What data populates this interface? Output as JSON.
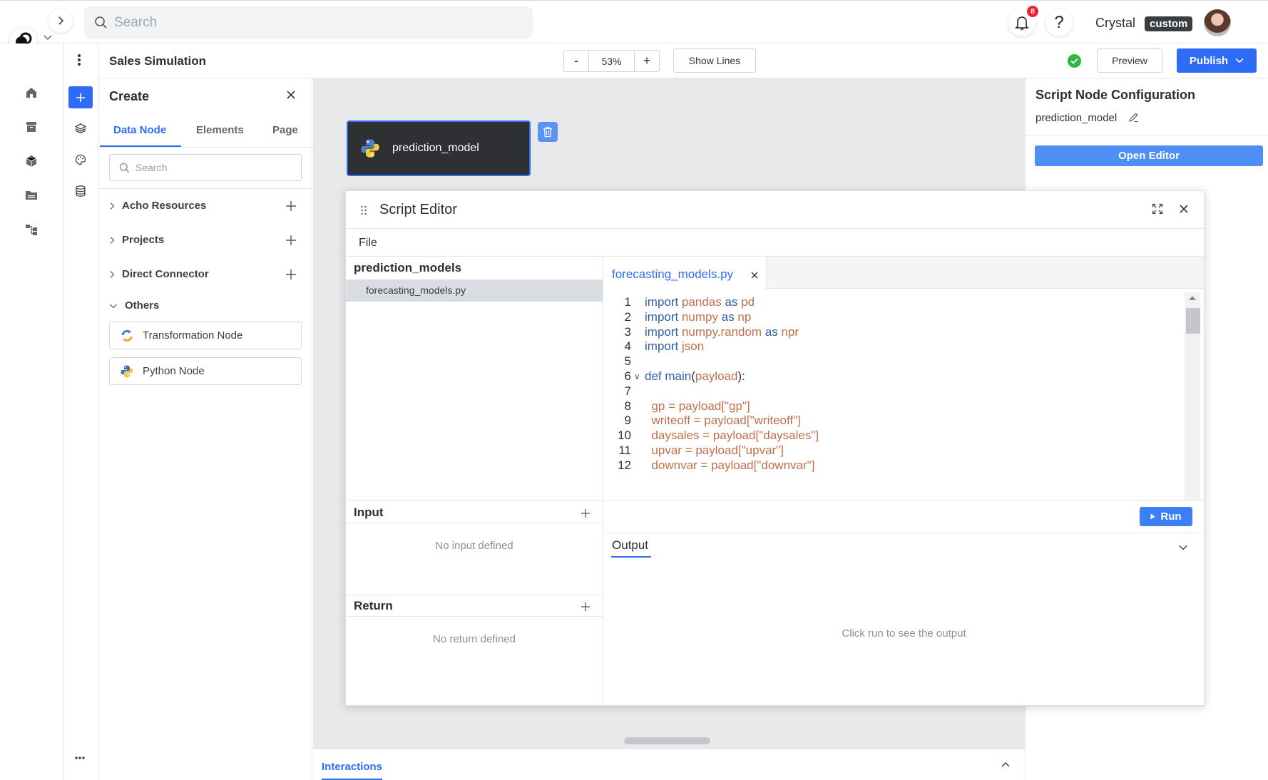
{
  "topbar": {
    "search_placeholder": "Search",
    "notifications_count": "8",
    "help_label": "?",
    "user_name": "Crystal",
    "user_role": "custom"
  },
  "header": {
    "project_title": "Sales Simulation",
    "zoom_minus": "-",
    "zoom_value": "53%",
    "zoom_plus": "+",
    "show_lines": "Show Lines",
    "preview": "Preview",
    "publish": "Publish",
    "status_color": "#2db742"
  },
  "create_panel": {
    "title": "Create",
    "tabs": [
      "Data Node",
      "Elements",
      "Page"
    ],
    "active_tab": "Data Node",
    "search_placeholder": "Search",
    "tree": [
      {
        "label": "Acho Resources"
      },
      {
        "label": "Projects"
      },
      {
        "label": "Direct Connector"
      },
      {
        "label": "Others"
      }
    ],
    "nodes": [
      {
        "label": "Transformation Node",
        "icon": "transformation-icon"
      },
      {
        "label": "Python Node",
        "icon": "python-icon"
      }
    ]
  },
  "canvas": {
    "node_label": "prediction_model"
  },
  "right_panel": {
    "title": "Script Node Configuration",
    "node_name": "prediction_model",
    "open_editor": "Open Editor"
  },
  "script_editor": {
    "title": "Script Editor",
    "menu_file": "File",
    "folder": "prediction_models",
    "file": "forecasting_models.py",
    "tab_label": "forecasting_models.py",
    "input_title": "Input",
    "input_empty": "No input defined",
    "return_title": "Return",
    "return_empty": "No return defined",
    "run": "Run",
    "output_tab": "Output",
    "output_msg": "Click run to see the output",
    "code_lines": [
      {
        "n": "1",
        "parts": [
          [
            "kw",
            "import "
          ],
          [
            "id",
            "pandas"
          ],
          [
            "kw",
            " as "
          ],
          [
            "id",
            "pd"
          ]
        ]
      },
      {
        "n": "2",
        "parts": [
          [
            "kw",
            "import "
          ],
          [
            "id",
            "numpy"
          ],
          [
            "kw",
            " as "
          ],
          [
            "id",
            "np"
          ]
        ]
      },
      {
        "n": "3",
        "parts": [
          [
            "kw",
            "import "
          ],
          [
            "id",
            "numpy.random"
          ],
          [
            "kw",
            " as "
          ],
          [
            "id",
            "npr"
          ]
        ]
      },
      {
        "n": "4",
        "parts": [
          [
            "kw",
            "import "
          ],
          [
            "id",
            "json"
          ]
        ]
      },
      {
        "n": "5",
        "parts": []
      },
      {
        "n": "6",
        "parts": [
          [
            "kw",
            "def "
          ],
          [
            "kw",
            "main"
          ],
          [
            "pl",
            "("
          ],
          [
            "id",
            "payload"
          ],
          [
            "pl",
            "):"
          ]
        ],
        "fold": true
      },
      {
        "n": "7",
        "parts": []
      },
      {
        "n": "8",
        "parts": [
          [
            "id",
            "  gp = payload["
          ],
          [
            "st",
            "\"gp\""
          ],
          [
            "id",
            "]"
          ]
        ]
      },
      {
        "n": "9",
        "parts": [
          [
            "id",
            "  writeoff = payload["
          ],
          [
            "st",
            "\"writeoff\""
          ],
          [
            "id",
            "]"
          ]
        ]
      },
      {
        "n": "10",
        "parts": [
          [
            "id",
            "  daysales = payload["
          ],
          [
            "st",
            "\"daysales\""
          ],
          [
            "id",
            "]"
          ]
        ]
      },
      {
        "n": "11",
        "parts": [
          [
            "id",
            "  upvar = payload["
          ],
          [
            "st",
            "\"upvar\""
          ],
          [
            "id",
            "]"
          ]
        ]
      },
      {
        "n": "12",
        "parts": [
          [
            "id",
            "  downvar = payload["
          ],
          [
            "st",
            "\"downvar\""
          ],
          [
            "id",
            "]"
          ]
        ]
      }
    ]
  },
  "interactions": {
    "tab_label": "Interactions"
  }
}
